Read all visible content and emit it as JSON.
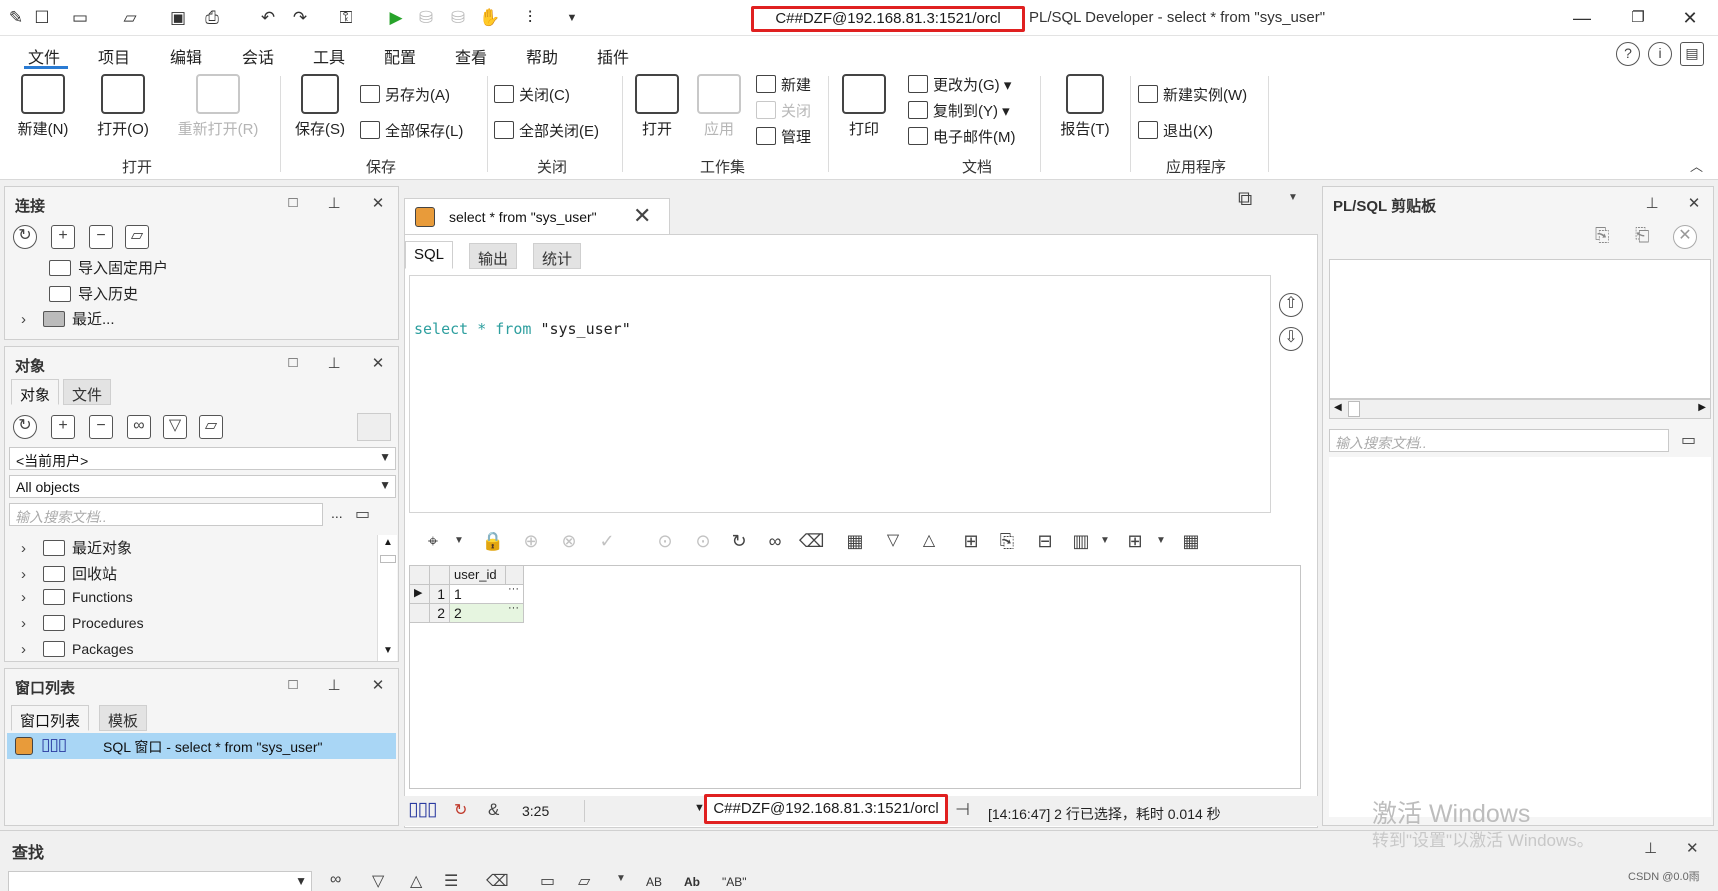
{
  "title": {
    "connection": "C##DZF@192.168.81.3:1521/orcl",
    "app": "PL/SQL Developer - select * from \"sys_user\""
  },
  "menu": [
    "文件",
    "项目",
    "编辑",
    "会话",
    "工具",
    "配置",
    "查看",
    "帮助",
    "插件"
  ],
  "ribbon": {
    "new": "新建(N)",
    "open": "打开(O)",
    "reopen": "重新打开(R)",
    "save": "保存(S)",
    "save_as": "另存为(A)",
    "save_all": "全部保存(L)",
    "close": "关闭(C)",
    "close_all": "全部关闭(E)",
    "ws_open": "打开",
    "ws_apply": "应用",
    "ws_new": "新建",
    "ws_close": "关闭",
    "ws_manage": "管理",
    "print": "打印",
    "change_to": "更改为(G)",
    "copy_to": "复制到(Y)",
    "email": "电子邮件(M)",
    "report": "报告(T)",
    "new_instance": "新建实例(W)",
    "exit": "退出(X)",
    "groups": [
      "打开",
      "保存",
      "关闭",
      "工作集",
      "文档",
      "应用程序"
    ]
  },
  "connections_panel": {
    "title": "连接",
    "items": [
      "导入固定用户",
      "导入历史",
      "最近..."
    ]
  },
  "objects_panel": {
    "title": "对象",
    "tabs": [
      "对象",
      "文件"
    ],
    "user_select": "<当前用户>",
    "type_select": "All objects",
    "search_placeholder": "输入搜索文档..",
    "tree": [
      "最近对象",
      "回收站",
      "Functions",
      "Procedures",
      "Packages"
    ]
  },
  "windows_panel": {
    "title": "窗口列表",
    "tabs": [
      "窗口列表",
      "模板"
    ],
    "items": [
      "SQL 窗口 - select * from \"sys_user\""
    ]
  },
  "editor": {
    "doc_tab": "select * from \"sys_user\"",
    "subtabs": [
      "SQL",
      "输出",
      "统计"
    ],
    "sql": {
      "kw1": "select",
      "star": "*",
      "kw2": "from",
      "table": "\"sys_user\""
    }
  },
  "result": {
    "columns": [
      "user_id"
    ],
    "rows": [
      {
        "num": "1",
        "user_id": "1"
      },
      {
        "num": "2",
        "user_id": "2"
      }
    ]
  },
  "statusbar": {
    "position": "3:25",
    "connection": "C##DZF@192.168.81.3:1521/orcl",
    "message": "[14:16:47]  2 行已选择，耗时 0.014 秒"
  },
  "clipboard_panel": {
    "title": "PL/SQL 剪贴板",
    "search_placeholder": "输入搜索文档.."
  },
  "find_panel": {
    "title": "查找",
    "btn_ab1": "AB",
    "btn_ab2": "Ab",
    "btn_ab3": "\"AB\""
  },
  "watermark": {
    "line1": "激活 Windows",
    "line2": "转到\"设置\"以激活 Windows。"
  },
  "credit": "CSDN @0.0雨"
}
